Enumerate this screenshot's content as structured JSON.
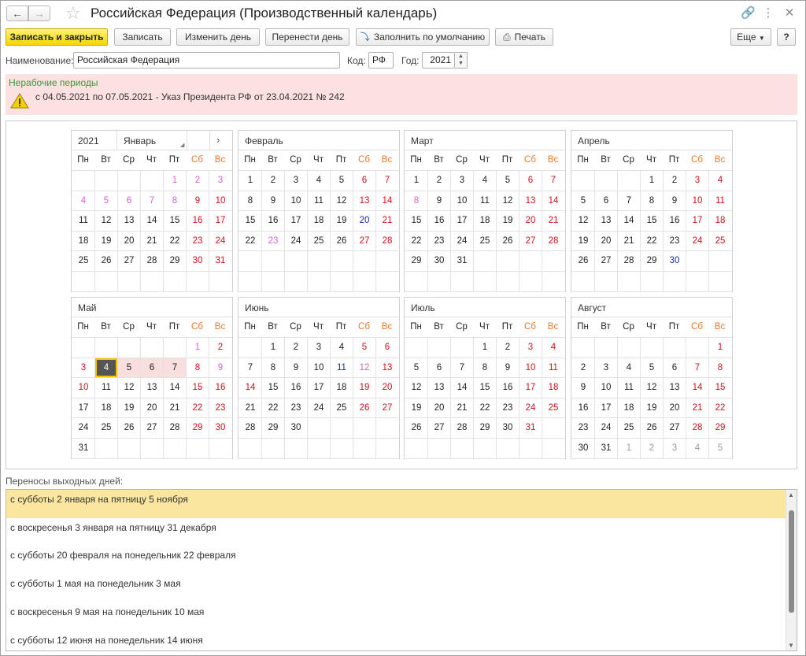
{
  "window": {
    "title": "Российская Федерация (Производственный календарь)"
  },
  "toolbar": {
    "save_close": "Записать и закрыть",
    "save": "Записать",
    "change_day": "Изменить день",
    "move_day": "Перенести день",
    "fill_default": "Заполнить по умолчанию",
    "print": "Печать",
    "more": "Еще",
    "help": "?"
  },
  "form": {
    "name_label": "Наименование:",
    "name_value": "Российская Федерация",
    "code_label": "Код:",
    "code_value": "РФ",
    "year_label": "Год:",
    "year_value": "2021"
  },
  "nonworking": {
    "title": "Нерабочие периоды",
    "text": "с 04.05.2021 по 07.05.2021 - Указ Президента РФ от 23.04.2021 № 242"
  },
  "calendar": {
    "year": "2021",
    "first_month_selector": "Январь",
    "weekdays": [
      "Пн",
      "Вт",
      "Ср",
      "Чт",
      "Пт",
      "Сб",
      "Вс"
    ],
    "months": [
      {
        "name": "Январь",
        "start": 4,
        "days": 31,
        "pink": [
          1,
          2,
          3,
          4,
          5,
          6,
          7,
          8
        ],
        "red": [
          9,
          10,
          16,
          17,
          23,
          24,
          30,
          31
        ],
        "blue": []
      },
      {
        "name": "Февраль",
        "start": 0,
        "days": 28,
        "pink": [
          23
        ],
        "red": [
          6,
          7,
          13,
          14,
          21,
          27,
          28
        ],
        "blue": [
          20
        ]
      },
      {
        "name": "Март",
        "start": 0,
        "days": 31,
        "pink": [
          8
        ],
        "red": [
          6,
          7,
          13,
          14,
          20,
          21,
          27,
          28
        ],
        "blue": []
      },
      {
        "name": "Апрель",
        "start": 3,
        "days": 30,
        "pink": [],
        "red": [
          3,
          4,
          10,
          11,
          17,
          18,
          24,
          25
        ],
        "blue": [
          30
        ]
      },
      {
        "name": "Май",
        "start": 5,
        "days": 31,
        "pink": [
          1,
          9
        ],
        "red": [
          2,
          3,
          8,
          10,
          15,
          16,
          22,
          23,
          29,
          30
        ],
        "blue": [],
        "selected": 4,
        "nonworking": [
          5,
          6,
          7
        ]
      },
      {
        "name": "Июнь",
        "start": 1,
        "days": 30,
        "pink": [
          12
        ],
        "red": [
          5,
          6,
          13,
          14,
          19,
          20,
          26,
          27
        ],
        "blue": [
          11
        ]
      },
      {
        "name": "Июль",
        "start": 3,
        "days": 31,
        "pink": [],
        "red": [
          3,
          4,
          10,
          11,
          17,
          18,
          24,
          25,
          31
        ],
        "blue": []
      },
      {
        "name": "Август",
        "start": 6,
        "days": 31,
        "pink": [],
        "red": [
          1,
          7,
          8,
          14,
          15,
          21,
          22,
          28,
          29
        ],
        "blue": [],
        "trailing": [
          1,
          2,
          3,
          4,
          5
        ]
      }
    ]
  },
  "transfers": {
    "label": "Переносы выходных дней:",
    "items": [
      "с субботы 2 января на пятницу 5 ноября",
      "с воскресенья 3 января на пятницу 31 декабря",
      "с субботы 20 февраля на понедельник 22 февраля",
      "с субботы 1 мая на понедельник 3 мая",
      "с воскресенья 9 мая на понедельник 10 мая",
      "с субботы 12 июня на понедельник 14 июня"
    ]
  }
}
